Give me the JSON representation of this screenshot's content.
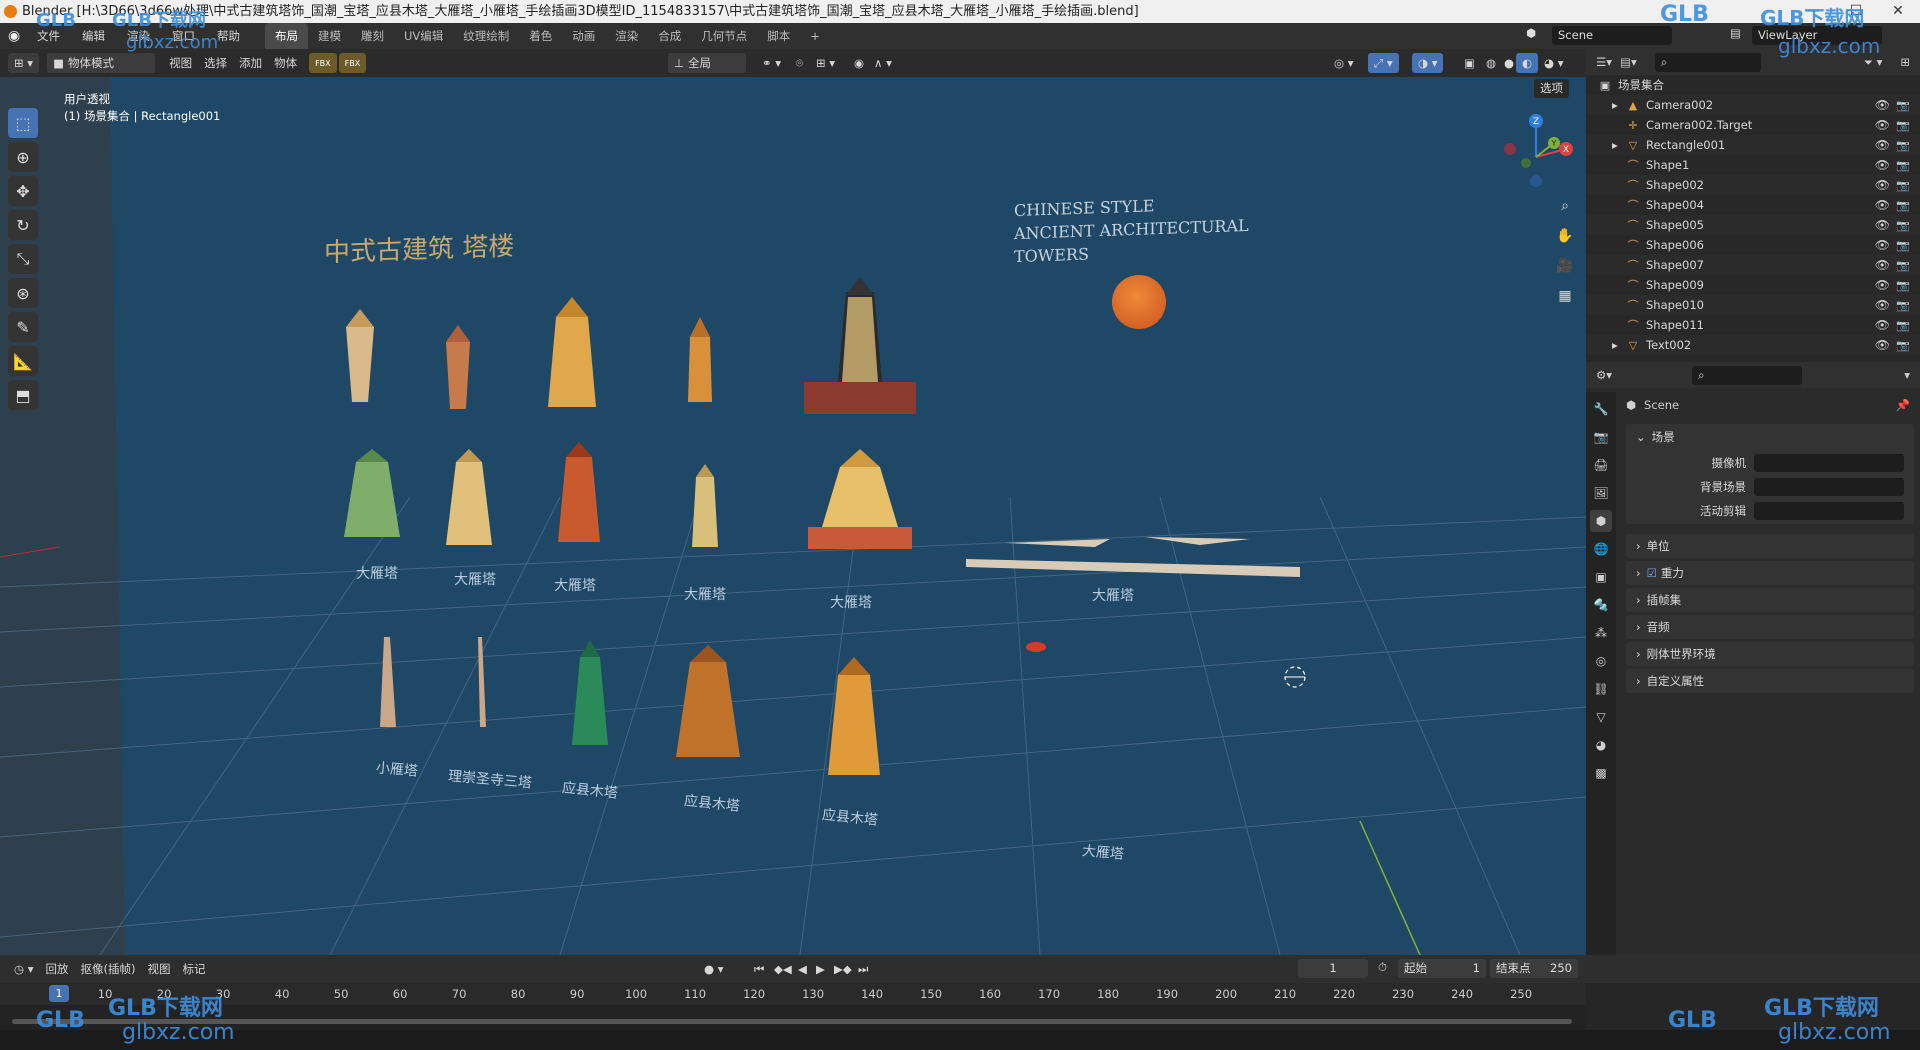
{
  "window": {
    "title": "Blender [H:\\3D66\\3d66w处理\\中式古建筑塔饰_国潮_宝塔_应县木塔_大雁塔_小雁塔_手绘插画3D模型ID_1154833157\\中式古建筑塔饰_国潮_宝塔_应县木塔_大雁塔_小雁塔_手绘插画.blend]",
    "minimize": "—",
    "maximize": "☐",
    "close": "✕"
  },
  "menu": [
    "文件",
    "编辑",
    "渲染",
    "窗口",
    "帮助"
  ],
  "workspaces": [
    "布局",
    "建模",
    "雕刻",
    "UV编辑",
    "纹理绘制",
    "着色",
    "动画",
    "渲染",
    "合成",
    "几何节点",
    "脚本"
  ],
  "add_workspace": "+",
  "scene": {
    "name": "Scene",
    "view_layer": "ViewLayer"
  },
  "viewport_header": {
    "mode": "物体模式",
    "menus": [
      "视图",
      "选择",
      "添加",
      "物体"
    ],
    "transform": "全局",
    "options": "选项"
  },
  "viewport": {
    "view_name": "用户透视",
    "context": "(1) 场景集合 | Rectangle001"
  },
  "gizmo": {
    "z": "Z",
    "y": "Y",
    "x": "X"
  },
  "scene_text": {
    "title_cn": "中式古建筑  塔楼",
    "title_en_1": "CHINESE STYLE",
    "title_en_2": "ANCIENT ARCHITECTURAL",
    "title_en_3": "TOWERS",
    "row2": [
      "大雁塔",
      "大雁塔",
      "大雁塔",
      "大雁塔",
      "大雁塔",
      "大雁塔"
    ],
    "row3": [
      "小雁塔",
      "理崇圣寺三塔",
      "应县木塔",
      "应县木塔",
      "应县木塔",
      "大雁塔"
    ]
  },
  "outliner": {
    "root": "场景集合",
    "items": [
      {
        "name": "Camera002",
        "icon": "camera-object-icon",
        "expand": true
      },
      {
        "name": "Camera002.Target",
        "icon": "empty-object-icon",
        "expand": false
      },
      {
        "name": "Rectangle001",
        "icon": "mesh-object-icon",
        "expand": true
      },
      {
        "name": "Shape1",
        "icon": "curve-object-icon",
        "expand": false
      },
      {
        "name": "Shape002",
        "icon": "curve-object-icon",
        "expand": false
      },
      {
        "name": "Shape004",
        "icon": "curve-object-icon",
        "expand": false
      },
      {
        "name": "Shape005",
        "icon": "curve-object-icon",
        "expand": false
      },
      {
        "name": "Shape006",
        "icon": "curve-object-icon",
        "expand": false
      },
      {
        "name": "Shape007",
        "icon": "curve-object-icon",
        "expand": false
      },
      {
        "name": "Shape009",
        "icon": "curve-object-icon",
        "expand": false
      },
      {
        "name": "Shape010",
        "icon": "curve-object-icon",
        "expand": false
      },
      {
        "name": "Shape011",
        "icon": "curve-object-icon",
        "expand": false
      },
      {
        "name": "Text002",
        "icon": "mesh-object-icon",
        "expand": true
      }
    ]
  },
  "properties": {
    "breadcrumb": "Scene",
    "section": "场景",
    "fields": [
      {
        "label": "摄像机",
        "value": ""
      },
      {
        "label": "背景场景",
        "value": ""
      },
      {
        "label": "活动剪辑",
        "value": ""
      }
    ],
    "subpanels": [
      "单位",
      "重力",
      "插帧集",
      "音频",
      "刚体世界环境",
      "自定义属性"
    ],
    "gravity_checked": true
  },
  "timeline": {
    "menus": [
      "回放",
      "抠像(插帧)",
      "视图",
      "标记"
    ],
    "current_frame": "1",
    "start_label": "起始",
    "start": "1",
    "end_label": "结束点",
    "end": "250",
    "ticks": [
      "1",
      "10",
      "20",
      "30",
      "40",
      "50",
      "60",
      "70",
      "80",
      "90",
      "100",
      "110",
      "120",
      "130",
      "140",
      "150",
      "160",
      "170",
      "180",
      "190",
      "200",
      "210",
      "220",
      "230",
      "240",
      "250"
    ]
  },
  "watermarks": {
    "brand": "GLB下载网",
    "url": "glbxz.com",
    "logo": "GLB"
  }
}
